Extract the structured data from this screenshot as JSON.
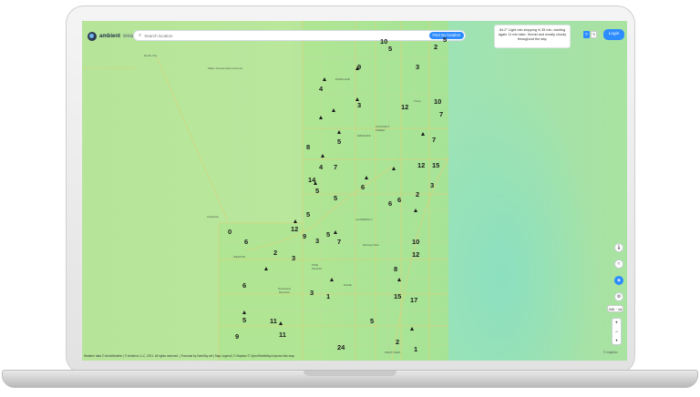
{
  "app": {
    "logo_name": "ambient",
    "logo_sub": "weather",
    "search_placeholder": "Search location",
    "find_button": "Find my location",
    "forecast": "84.2° Light rain stopping in 35 min, starting again 11 min later. Humid and mostly cloudy throughout the day.",
    "unit_f": "°F",
    "unit_c": "°C",
    "login": "Login",
    "range": "24h · 1d",
    "zoom_in": "+",
    "zoom_out": "−",
    "zoom_reset": "•",
    "credits": "Weather data © AerisWeather | © Ambient, LLC, 2021. All rights reserved. | Forecast by DarkSky.net | Map Legend | © Mapbox © OpenStreetMap Improve this map",
    "mapbox": "© mapbox"
  },
  "colors": {
    "accent": "#2d8cff",
    "land": "#b6e59a",
    "ocean": "#9ee3b5",
    "road": "#d9d27a"
  },
  "icons": [
    "search-icon",
    "thermometer-icon",
    "wind-icon",
    "layers-icon",
    "settings-icon"
  ],
  "places": [
    {
      "id": "p1",
      "name": "Devils City"
    },
    {
      "id": "p2",
      "name": "Water Conservation Area 2A"
    },
    {
      "id": "p3",
      "name": "PARKLAND"
    },
    {
      "id": "p4",
      "name": "Tinley"
    },
    {
      "id": "p5",
      "name": "COCONUT CREEK"
    },
    {
      "id": "p6",
      "name": "MARGATE"
    },
    {
      "id": "p7",
      "name": "LAUDERHILL"
    },
    {
      "id": "p8",
      "name": "Andytown"
    },
    {
      "id": "p9",
      "name": "Melrose Park"
    },
    {
      "id": "p10",
      "name": "WESTON"
    },
    {
      "id": "p11",
      "name": "Southwest Ranches"
    },
    {
      "id": "p12",
      "name": "PINE ISLAND"
    },
    {
      "id": "p13",
      "name": "DAVIE"
    },
    {
      "id": "p14",
      "name": "WEST PARK"
    }
  ],
  "stations": [
    {
      "id": "s1",
      "v": "10"
    },
    {
      "id": "s2",
      "v": "5"
    },
    {
      "id": "s3",
      "v": "2"
    },
    {
      "id": "s4",
      "v": "5"
    },
    {
      "id": "s5",
      "v": "9"
    },
    {
      "id": "s6",
      "v": "3"
    },
    {
      "id": "s7",
      "v": "4"
    },
    {
      "id": "s8",
      "v": "3"
    },
    {
      "id": "s9",
      "v": "10"
    },
    {
      "id": "s10",
      "v": "7"
    },
    {
      "id": "s11",
      "v": "12"
    },
    {
      "id": "s12",
      "v": "5"
    },
    {
      "id": "s13",
      "v": "8"
    },
    {
      "id": "s14",
      "v": "7"
    },
    {
      "id": "s15",
      "v": "7"
    },
    {
      "id": "s16",
      "v": "4"
    },
    {
      "id": "s17",
      "v": "12"
    },
    {
      "id": "s18",
      "v": "15"
    },
    {
      "id": "s19",
      "v": "14"
    },
    {
      "id": "s20",
      "v": "5"
    },
    {
      "id": "s21",
      "v": "6"
    },
    {
      "id": "s22",
      "v": "5"
    },
    {
      "id": "s23",
      "v": "2"
    },
    {
      "id": "s24",
      "v": "3"
    },
    {
      "id": "s25",
      "v": "6"
    },
    {
      "id": "s26",
      "v": "6"
    },
    {
      "id": "s27",
      "v": "5"
    },
    {
      "id": "s28",
      "v": "0"
    },
    {
      "id": "s29",
      "v": "12"
    },
    {
      "id": "s30",
      "v": "9"
    },
    {
      "id": "s31",
      "v": "3"
    },
    {
      "id": "s32",
      "v": "5"
    },
    {
      "id": "s33",
      "v": "7"
    },
    {
      "id": "s34",
      "v": "10"
    },
    {
      "id": "s35",
      "v": "6"
    },
    {
      "id": "s36",
      "v": "2"
    },
    {
      "id": "s37",
      "v": "3"
    },
    {
      "id": "s38",
      "v": "12"
    },
    {
      "id": "s39",
      "v": "8"
    },
    {
      "id": "s40",
      "v": "6"
    },
    {
      "id": "s41",
      "v": "3"
    },
    {
      "id": "s42",
      "v": "1"
    },
    {
      "id": "s43",
      "v": "15"
    },
    {
      "id": "s44",
      "v": "17"
    },
    {
      "id": "s45",
      "v": "5"
    },
    {
      "id": "s46",
      "v": "11"
    },
    {
      "id": "s47",
      "v": "5"
    },
    {
      "id": "s48",
      "v": "11"
    },
    {
      "id": "s49",
      "v": "9"
    },
    {
      "id": "s50",
      "v": "24"
    },
    {
      "id": "s51",
      "v": "2"
    },
    {
      "id": "s52",
      "v": "1"
    }
  ]
}
